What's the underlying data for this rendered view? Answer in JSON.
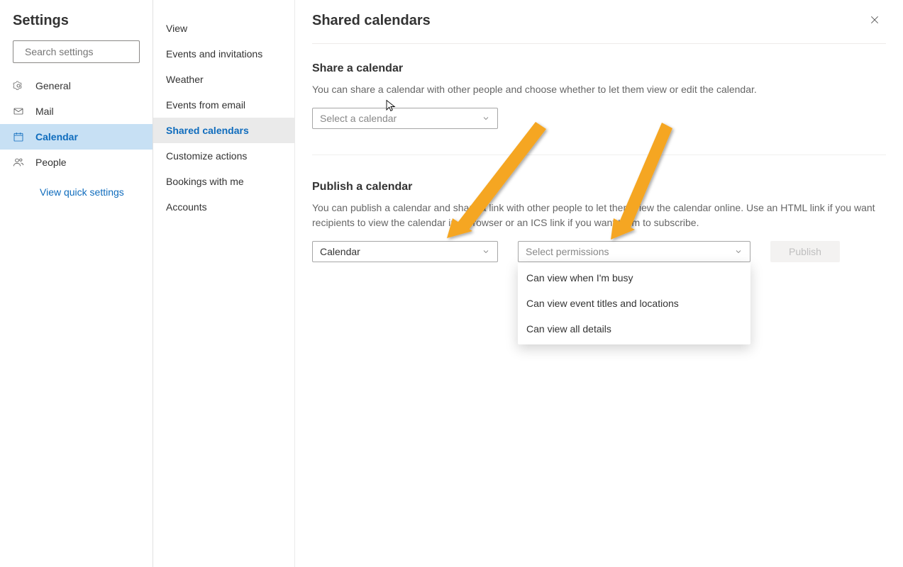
{
  "sidebar": {
    "title": "Settings",
    "search_placeholder": "Search settings",
    "items": [
      {
        "label": "General"
      },
      {
        "label": "Mail"
      },
      {
        "label": "Calendar"
      },
      {
        "label": "People"
      }
    ],
    "quick_link": "View quick settings"
  },
  "subnav": {
    "items": [
      {
        "label": "View"
      },
      {
        "label": "Events and invitations"
      },
      {
        "label": "Weather"
      },
      {
        "label": "Events from email"
      },
      {
        "label": "Shared calendars"
      },
      {
        "label": "Customize actions"
      },
      {
        "label": "Bookings with me"
      },
      {
        "label": "Accounts"
      }
    ]
  },
  "content": {
    "title": "Shared calendars",
    "share": {
      "heading": "Share a calendar",
      "desc": "You can share a calendar with other people and choose whether to let them view or edit the calendar.",
      "select_placeholder": "Select a calendar"
    },
    "publish": {
      "heading": "Publish a calendar",
      "desc": "You can publish a calendar and share a link with other people to let them view the calendar online. Use an HTML link if you want recipients to view the calendar in a browser or an ICS link if you want them to subscribe.",
      "calendar_value": "Calendar",
      "permissions_placeholder": "Select permissions",
      "options": [
        "Can view when I'm busy",
        "Can view event titles and locations",
        "Can view all details"
      ],
      "button": "Publish"
    }
  }
}
